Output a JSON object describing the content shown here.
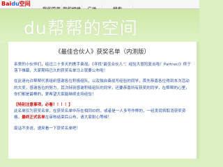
{
  "topbar": {
    "logo_text": "Bai",
    "logo_mark": "du",
    "logo_suffix": "空间",
    "nav": [
      "我的首页",
      "我的相册",
      "广场",
      "搜索"
    ]
  },
  "header": {
    "title": "du帮帮的空间"
  },
  "post": {
    "title": "《最佳合伙人》获奖名单（内测版）",
    "para1": "亲爱的小伙伴们，经过二十多天的携手奋战，《寻找\"最佳合伙人\"：经验大冒险复出啦！Partner/》终于落下帷幕，大家期待已久的获奖名单马上就要公布啦！",
    "para2": "在此请允许帮帮代表组织感谢各位积极组队，以及独自奋战写经验的同学，首先恭喜各位得到本次活动的大奖，感谢各位的努力，其次特别感谢积极组队的同学，还要恭喜所有获奖的同学，在帮帮的心里，你们都是最棒的，更希望大家能继续支持经验！",
    "notice_head": "【特别注意事项，必看！！！！】",
    "notice_body1": "此名单仅为获奖名单，在获奖名单中存在相同ID的，或者是一人多号作弊的，一经发现将取消获奖资格，",
    "notice_red": "最终正式名单",
    "notice_body2": "在审核结束后公布，请大家耐心等候！",
    "final_line": "废话不多说，速来看一下获奖名单吧！"
  }
}
